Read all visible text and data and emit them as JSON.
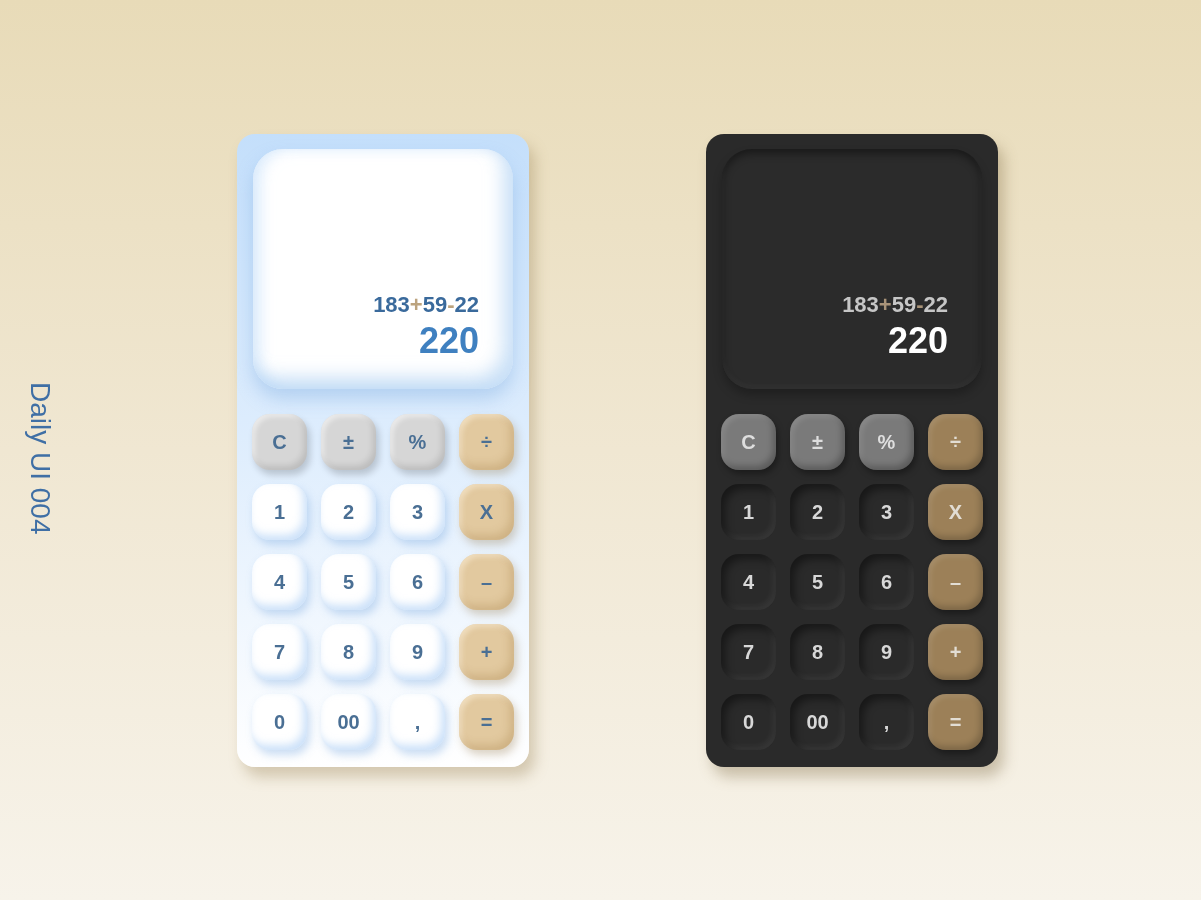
{
  "caption": "Daily UI 004",
  "calculators": [
    {
      "kind": "light",
      "display": {
        "expression": [
          {
            "text": "183",
            "kind": "number"
          },
          {
            "text": "+",
            "kind": "operator"
          },
          {
            "text": "59",
            "kind": "number"
          },
          {
            "text": "-",
            "kind": "operator"
          },
          {
            "text": "22",
            "kind": "number"
          }
        ],
        "result": "220"
      },
      "keys": [
        {
          "label": "C",
          "kind": "function"
        },
        {
          "label": "±",
          "kind": "function"
        },
        {
          "label": "%",
          "kind": "function"
        },
        {
          "label": "÷",
          "kind": "operator"
        },
        {
          "label": "1",
          "kind": "digit"
        },
        {
          "label": "2",
          "kind": "digit"
        },
        {
          "label": "3",
          "kind": "digit"
        },
        {
          "label": "X",
          "kind": "operator"
        },
        {
          "label": "4",
          "kind": "digit"
        },
        {
          "label": "5",
          "kind": "digit"
        },
        {
          "label": "6",
          "kind": "digit"
        },
        {
          "label": "–",
          "kind": "operator"
        },
        {
          "label": "7",
          "kind": "digit"
        },
        {
          "label": "8",
          "kind": "digit"
        },
        {
          "label": "9",
          "kind": "digit"
        },
        {
          "label": "+",
          "kind": "operator"
        },
        {
          "label": "0",
          "kind": "digit"
        },
        {
          "label": "00",
          "kind": "digit"
        },
        {
          "label": ",",
          "kind": "digit"
        },
        {
          "label": "=",
          "kind": "operator"
        }
      ]
    },
    {
      "kind": "dark",
      "display": {
        "expression": [
          {
            "text": "183",
            "kind": "number"
          },
          {
            "text": "+",
            "kind": "operator"
          },
          {
            "text": "59",
            "kind": "number"
          },
          {
            "text": "-",
            "kind": "operator"
          },
          {
            "text": "22",
            "kind": "number"
          }
        ],
        "result": "220"
      },
      "keys": [
        {
          "label": "C",
          "kind": "function"
        },
        {
          "label": "±",
          "kind": "function"
        },
        {
          "label": "%",
          "kind": "function"
        },
        {
          "label": "÷",
          "kind": "operator"
        },
        {
          "label": "1",
          "kind": "digit"
        },
        {
          "label": "2",
          "kind": "digit"
        },
        {
          "label": "3",
          "kind": "digit"
        },
        {
          "label": "X",
          "kind": "operator"
        },
        {
          "label": "4",
          "kind": "digit"
        },
        {
          "label": "5",
          "kind": "digit"
        },
        {
          "label": "6",
          "kind": "digit"
        },
        {
          "label": "–",
          "kind": "operator"
        },
        {
          "label": "7",
          "kind": "digit"
        },
        {
          "label": "8",
          "kind": "digit"
        },
        {
          "label": "9",
          "kind": "digit"
        },
        {
          "label": "+",
          "kind": "operator"
        },
        {
          "label": "0",
          "kind": "digit"
        },
        {
          "label": "00",
          "kind": "digit"
        },
        {
          "label": ",",
          "kind": "digit"
        },
        {
          "label": "=",
          "kind": "operator"
        }
      ]
    }
  ]
}
